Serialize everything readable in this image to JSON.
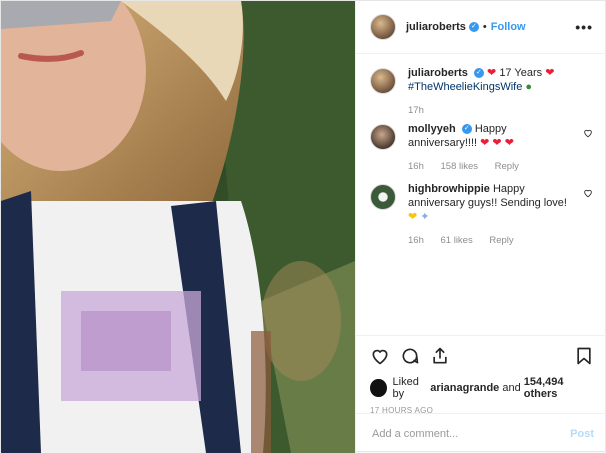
{
  "header": {
    "username": "juliaroberts",
    "dot": "•",
    "follow": "Follow",
    "more": "•••"
  },
  "caption": {
    "username": "juliaroberts",
    "text": "17 Years",
    "hashtag": "#TheWheelieKingsWife",
    "time": "17h"
  },
  "comments": [
    {
      "username": "mollyyeh",
      "text": "Happy anniversary!!!!",
      "time": "16h",
      "likes": "158 likes",
      "reply": "Reply"
    },
    {
      "username": "highbrowhippie",
      "text": "Happy anniversary guys!! Sending love!",
      "time": "16h",
      "likes": "61 likes",
      "reply": "Reply"
    }
  ],
  "likes": {
    "text": "Liked by ",
    "user": "arianagrande",
    "and": " and ",
    "count": "154,494 others"
  },
  "timeago": "17 HOURS AGO",
  "add_comment": {
    "placeholder": "Add a comment...",
    "post": "Post"
  },
  "colors": {
    "accent": "#3897f0",
    "heart_red": "#ed1c3a",
    "post_disabled": "#b3dbff"
  }
}
